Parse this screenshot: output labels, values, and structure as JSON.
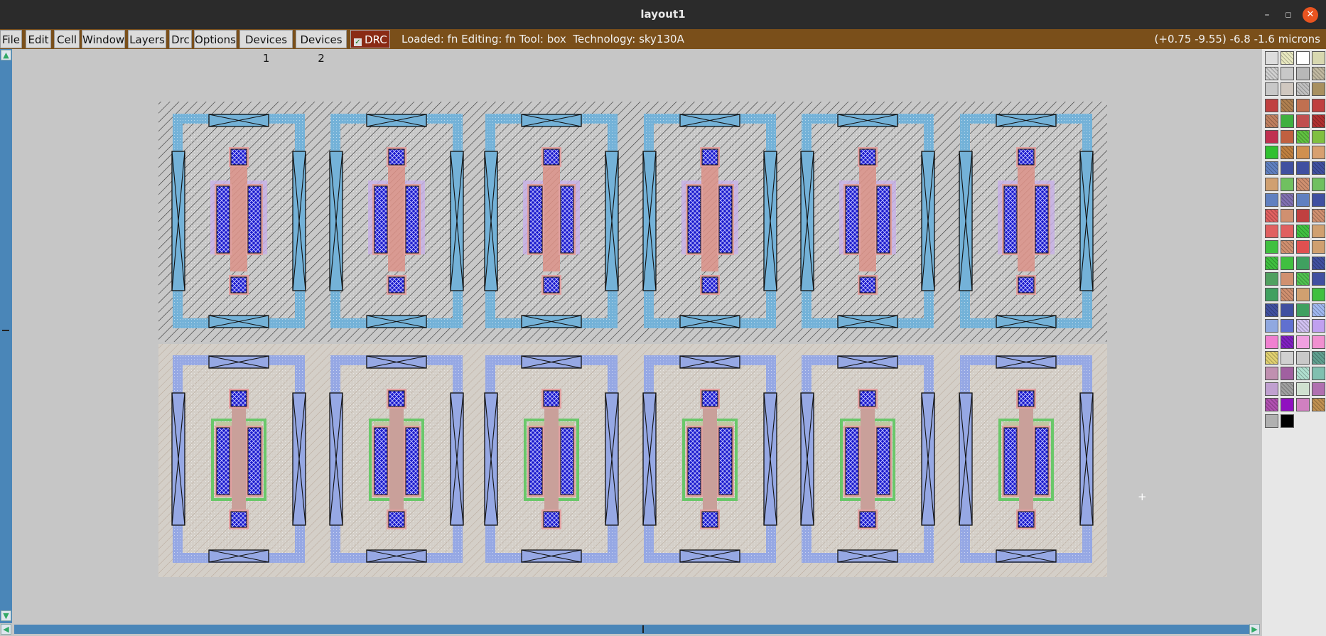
{
  "window": {
    "title": "layout1",
    "minimize_glyph": "–",
    "maximize_glyph": "◻",
    "close_glyph": "✕"
  },
  "menu": [
    "File",
    "Edit",
    "Cell",
    "Window",
    "Layers",
    "Drc",
    "Options",
    "Devices 1",
    "Devices 2"
  ],
  "drc": {
    "label": "DRC",
    "checked": true
  },
  "status": {
    "text": "Loaded: fn Editing: fn Tool: box  Technology: sky130A",
    "coords": "(+0.75 -9.55) -6.8 -1.6 microns"
  },
  "layout": {
    "top_row": {
      "device_count": 6,
      "well_color": "#74b2d8",
      "gate_color": "#d99a92"
    },
    "bottom_row": {
      "device_count": 6,
      "well_color": "#96a8e4",
      "gate_color": "#c9a09a",
      "diff_outline_color": "#6ac86a"
    },
    "contact_color": "#1a1acd",
    "icons": [
      "crosshair-cursor-icon",
      "scroll-up-icon",
      "scroll-down-icon",
      "scroll-left-icon",
      "scroll-right-icon",
      "checkbox-icon"
    ]
  },
  "palette": {
    "colors": [
      "#dddddd",
      "#e8e8c0",
      "#ffffff",
      "#d8d8b0",
      "#d0d0d0",
      "#c8c8c8",
      "#b8b8b8",
      "#c0b8a0",
      "#c8c8c8",
      "#d0c8c0",
      "#c0c0c0",
      "#a89060",
      "#c04040",
      "#b08050",
      "#c07050",
      "#c04040",
      "#c08060",
      "#40b040",
      "#c05050",
      "#b03030",
      "#c03050",
      "#c06040",
      "#60c040",
      "#80c040",
      "#30c030",
      "#c08040",
      "#d09050",
      "#d8a070",
      "#6080c0",
      "#4050a0",
      "#4050a0",
      "#4050a0",
      "#d0a070",
      "#70c060",
      "#d09070",
      "#70c060",
      "#6080c0",
      "#8070b0",
      "#6080c0",
      "#4050a0",
      "#e06060",
      "#d09070",
      "#c04040",
      "#d09070",
      "#e06060",
      "#e06060",
      "#40c040",
      "#d0a070",
      "#40c040",
      "#d09070",
      "#e05050",
      "#d0a070",
      "#40c040",
      "#40c040",
      "#40a060",
      "#4050a0",
      "#50a060",
      "#d09070",
      "#50c050",
      "#4050a0",
      "#40a060",
      "#d09070",
      "#d0a070",
      "#40c040",
      "#4050a0",
      "#4050a0",
      "#40a060",
      "#a0b8f0",
      "#90a8e0",
      "#6070d0",
      "#d0c0f0",
      "#c0a0f0",
      "#f080d0",
      "#8020c0",
      "#f0a0e0",
      "#f090d0",
      "#e0d070",
      "#d0d0d0",
      "#c8c8c8",
      "#60a090",
      "#c090b0",
      "#a060a0",
      "#b0e0d0",
      "#80c0b0",
      "#c0a0d0",
      "#a0a0a0",
      "#d0e0d0",
      "#b070b0",
      "#b050b0",
      "#9010c0",
      "#d080c0",
      "#c09050",
      "#b0b0b0",
      "#000000"
    ]
  }
}
